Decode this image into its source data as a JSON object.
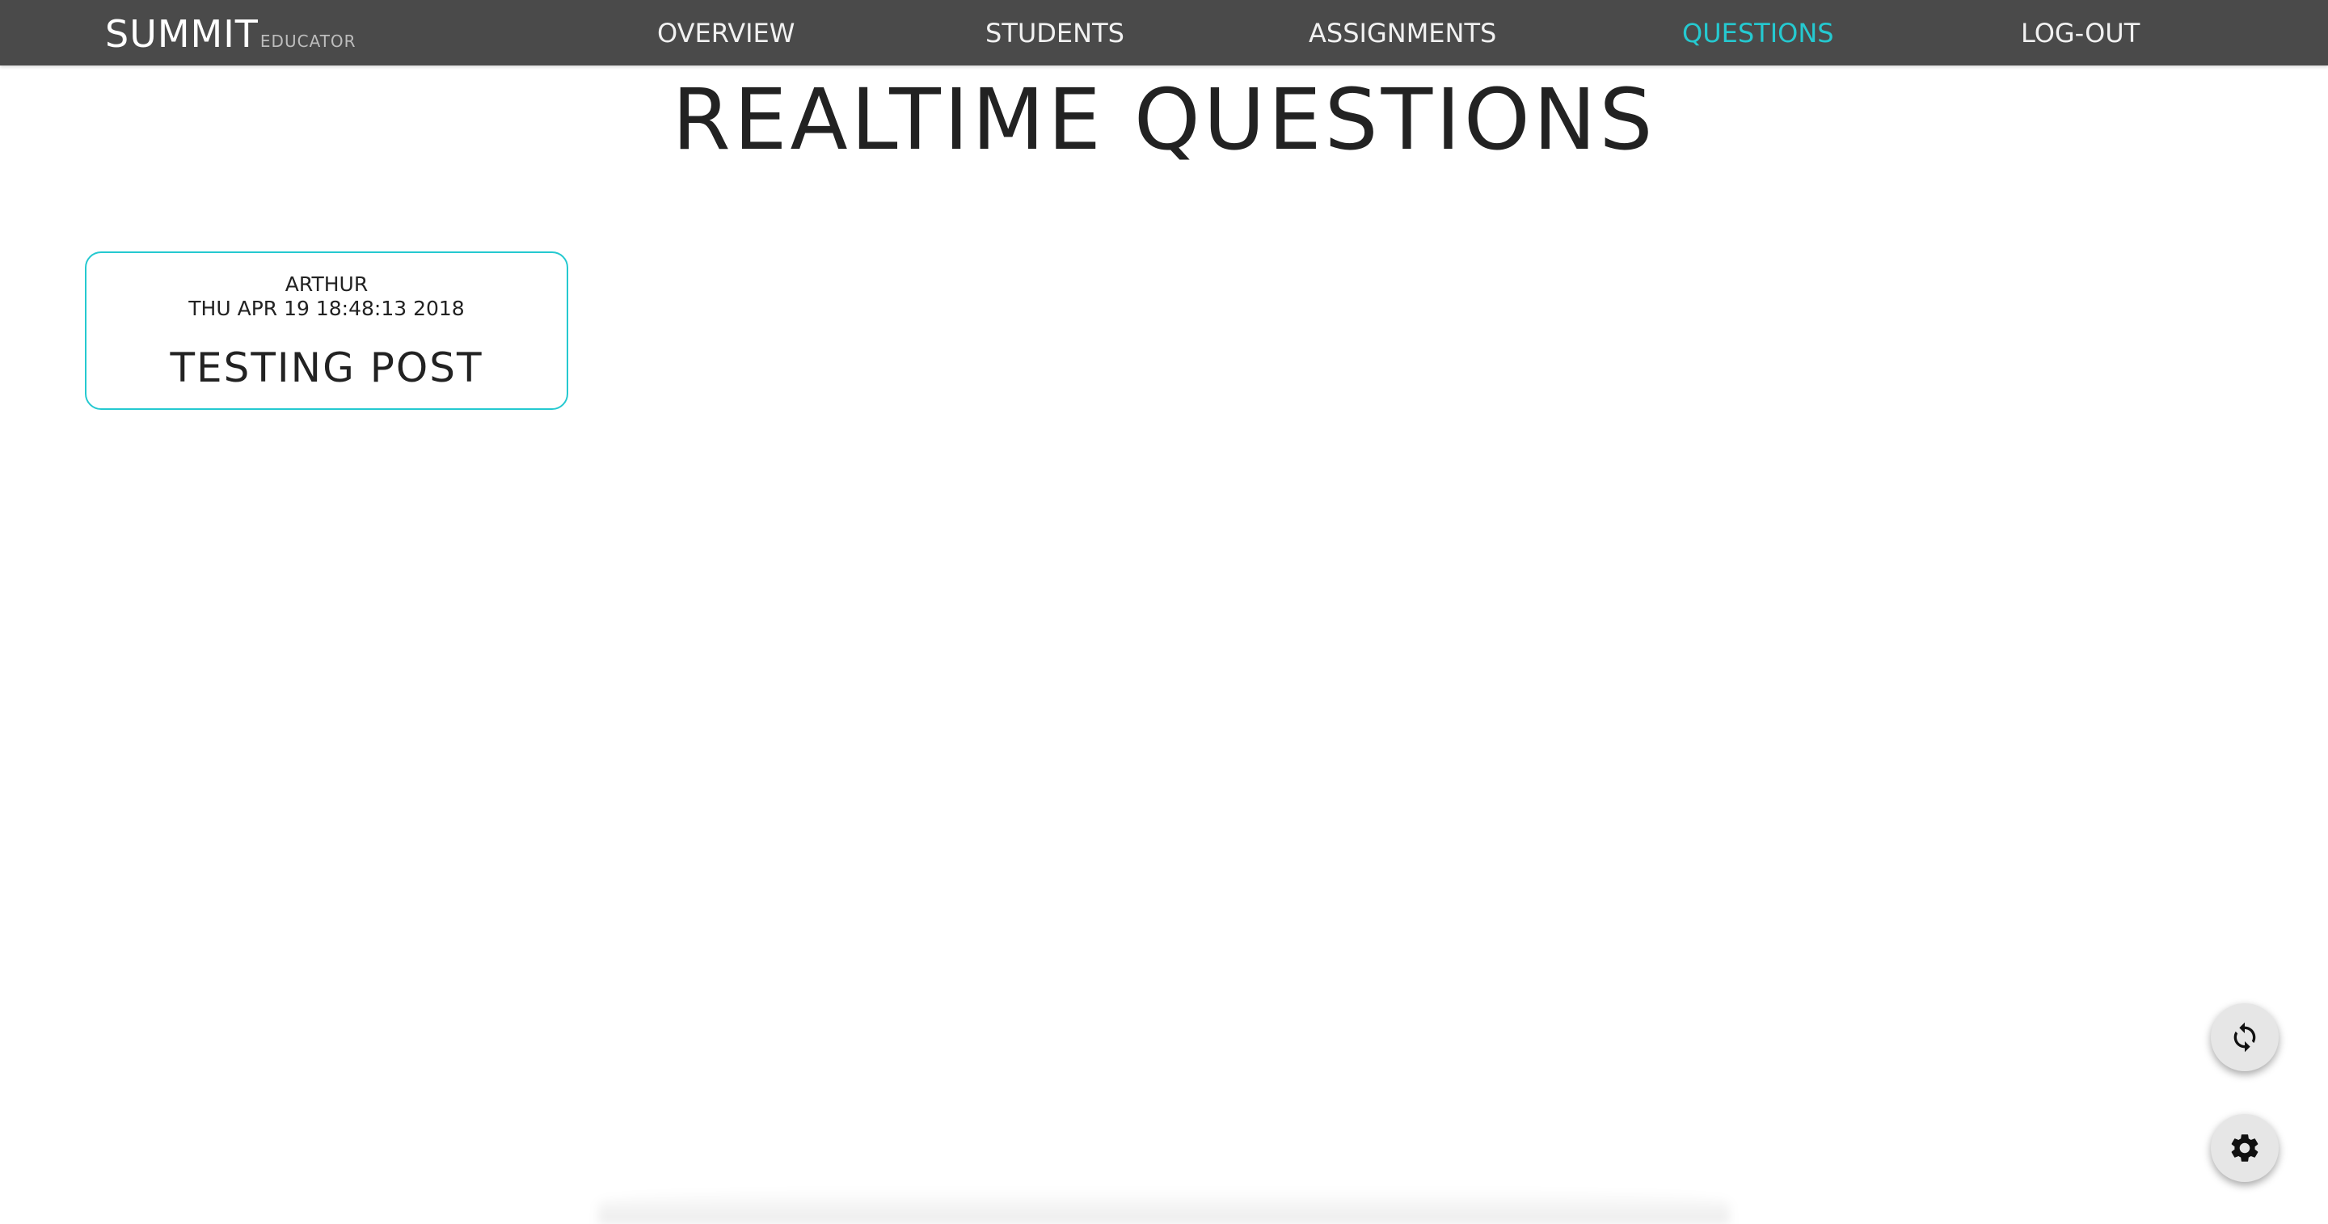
{
  "brand": {
    "main": "SUMMIT",
    "sub": "EDUCATOR"
  },
  "nav": {
    "items": [
      {
        "label": "OVERVIEW"
      },
      {
        "label": "STUDENTS"
      },
      {
        "label": "ASSIGNMENTS"
      },
      {
        "label": "QUESTIONS",
        "active": true
      },
      {
        "label": "LOG-OUT"
      }
    ]
  },
  "page": {
    "title": "REALTIME QUESTIONS"
  },
  "questions": [
    {
      "author": "ARTHUR",
      "date": "THU APR 19 18:48:13 2018",
      "title": "TESTING POST"
    }
  ],
  "fabs": {
    "refresh_icon": "refresh-icon",
    "settings_icon": "gear-icon"
  },
  "colors": {
    "navbar_bg": "#4a4a4a",
    "accent": "#25c9d0",
    "text": "#222222",
    "fab_bg": "#e6e6e6"
  }
}
